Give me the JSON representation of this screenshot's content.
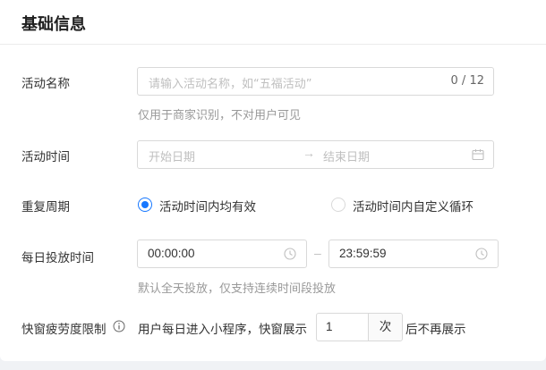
{
  "section": {
    "title": "基础信息"
  },
  "activity_name": {
    "label": "活动名称",
    "placeholder": "请输入活动名称，如“五福活动”",
    "counter": "0 / 12",
    "help": "仅用于商家识别，不对用户可见"
  },
  "activity_time": {
    "label": "活动时间",
    "start_placeholder": "开始日期",
    "arrow": "→",
    "end_placeholder": "结束日期"
  },
  "repeat_cycle": {
    "label": "重复周期",
    "options": [
      {
        "label": "活动时间内均有效",
        "checked": true
      },
      {
        "label": "活动时间内自定义循环",
        "checked": false
      }
    ]
  },
  "daily_time": {
    "label": "每日投放时间",
    "start": "00:00:00",
    "separator": "–",
    "end": "23:59:59",
    "help": "默认全天投放，仅支持连续时间段投放"
  },
  "popup_limit": {
    "label": "快窗疲劳度限制",
    "prefix": "用户每日进入小程序，快窗展示",
    "value": "1",
    "unit": "次",
    "suffix": "后不再展示"
  },
  "colors": {
    "accent": "#1677ff",
    "border": "#d9d9d9",
    "placeholder": "#bfbfbf",
    "help": "#999999"
  }
}
